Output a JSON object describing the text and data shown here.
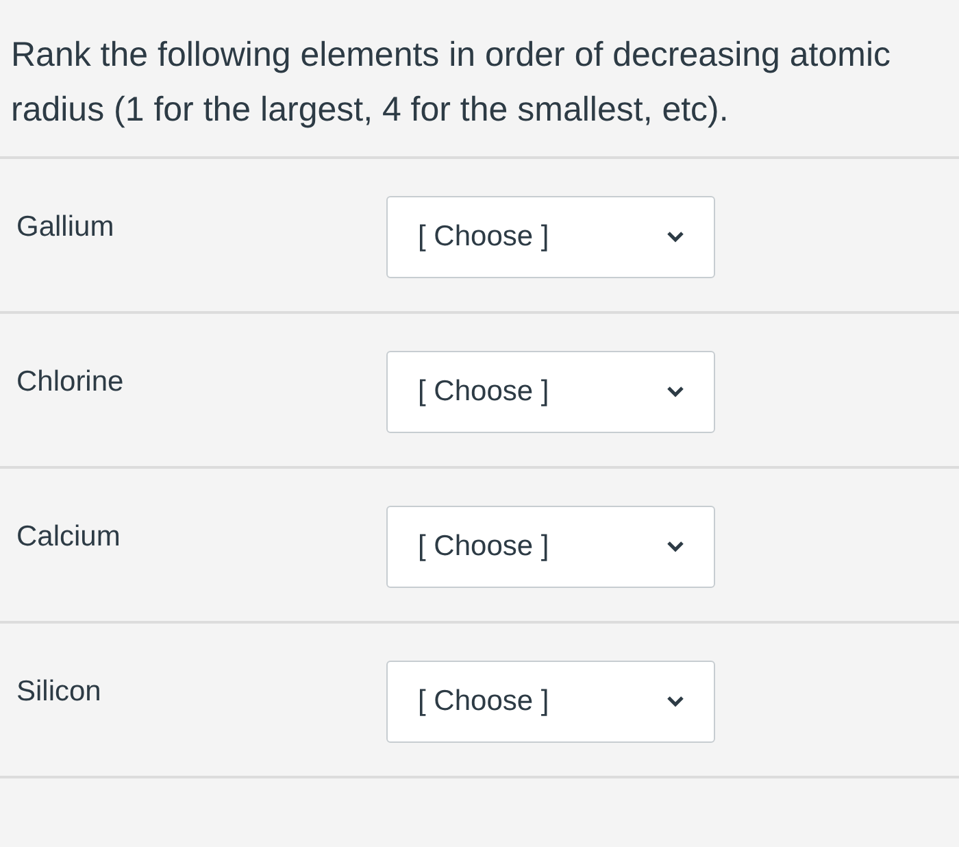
{
  "question": "Rank the following elements in order of decreasing atomic radius (1 for the largest, 4 for the smallest, etc).",
  "rows": [
    {
      "label": "Gallium",
      "select": {
        "placeholder": "[ Choose ]"
      }
    },
    {
      "label": "Chlorine",
      "select": {
        "placeholder": "[ Choose ]"
      }
    },
    {
      "label": "Calcium",
      "select": {
        "placeholder": "[ Choose ]"
      }
    },
    {
      "label": "Silicon",
      "select": {
        "placeholder": "[ Choose ]"
      }
    }
  ]
}
